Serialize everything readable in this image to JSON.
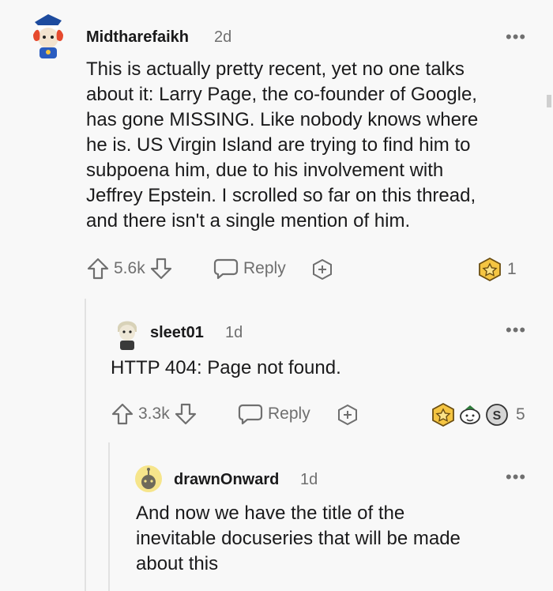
{
  "comments": [
    {
      "username": "Midtharefaikh",
      "time": "2d",
      "body_lines": [
        "This is actually pretty recent, yet no one talks",
        "about it: Larry Page, the co-founder of Google,",
        "has gone MISSING. Like nobody knows where",
        "he is. US Virgin Island are trying to find him to",
        "subpoena him, due to his involvement with",
        "Jeffrey Epstein. I scrolled so far on this thread,",
        "and there isn't a single mention of him."
      ],
      "votes": "5.6k",
      "reply_label": "Reply",
      "award_count": "1"
    },
    {
      "username": "sleet01",
      "time": "1d",
      "body_lines": [
        "HTTP 404: Page not found."
      ],
      "votes": "3.3k",
      "reply_label": "Reply",
      "award_count": "5"
    },
    {
      "username": "drawnOnward",
      "time": "1d",
      "body_lines": [
        "And now we have the title of the",
        "inevitable docuseries that will be made",
        "about this"
      ]
    }
  ],
  "more_label": "•••",
  "colors": {
    "background": "#f8f8f8",
    "text": "#1a1a1b",
    "muted": "#6f6f6f",
    "award_gold": "#f5c542"
  }
}
